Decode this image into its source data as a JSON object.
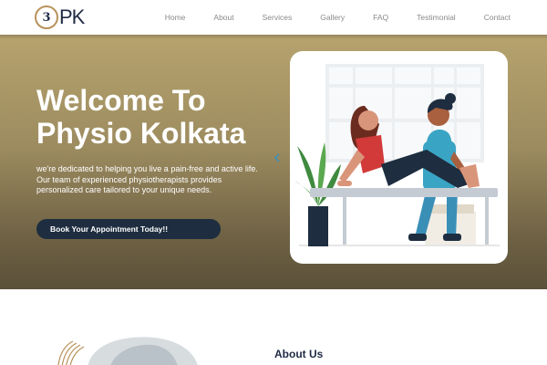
{
  "brand": {
    "logo_mark": "3",
    "logo_text": "PK",
    "gold": "#b8935a",
    "navy": "#1e2d3f"
  },
  "nav": {
    "items": [
      "Home",
      "About",
      "Services",
      "Gallery",
      "FAQ",
      "Testimonial",
      "Contact"
    ]
  },
  "hero": {
    "title_line1": "Welcome To",
    "title_line2": "Physio Kolkata",
    "description": "we're dedicated to helping you live a pain-free and active life. Our team of experienced physiotherapists provides personalized care tailored to your unique needs.",
    "cta_label": "Book Your Appointment Today!!",
    "image_icon": "physiotherapy-illustration",
    "arrow_icon": "chevron-left-icon"
  },
  "about": {
    "title": "About Us"
  }
}
